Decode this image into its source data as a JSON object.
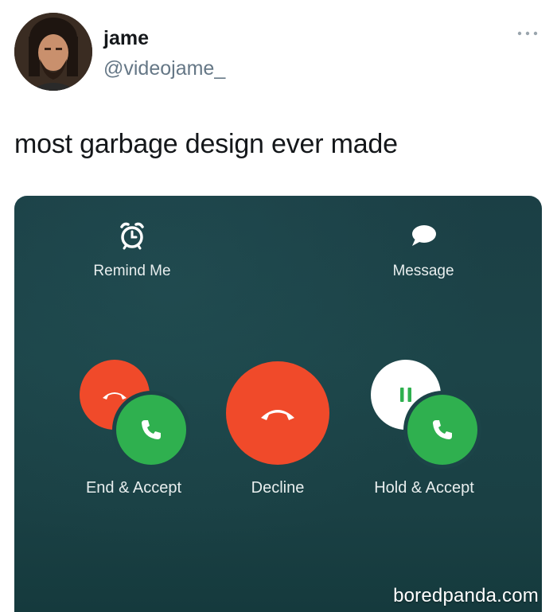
{
  "tweet": {
    "display_name": "jame",
    "handle": "@videojame_",
    "text": "most garbage design ever made",
    "avatar": "avatar-photo",
    "more_icon": "more-dots-icon"
  },
  "call_screen": {
    "top_actions": [
      {
        "label": "Remind Me",
        "icon": "alarm-clock-icon"
      },
      {
        "label": "Message",
        "icon": "speech-bubble-icon"
      }
    ],
    "buttons": [
      {
        "label": "End & Accept",
        "icons": [
          "hang-up-icon",
          "phone-icon"
        ]
      },
      {
        "label": "Decline",
        "icons": [
          "hang-up-icon"
        ]
      },
      {
        "label": "Hold & Accept",
        "icons": [
          "pause-icon",
          "phone-icon"
        ]
      }
    ]
  },
  "colors": {
    "decline_red": "#f04a2a",
    "accept_green": "#2fb04f",
    "screen_teal": "#1c4448",
    "handle_gray": "#657786"
  },
  "watermark": "boredpanda.com"
}
